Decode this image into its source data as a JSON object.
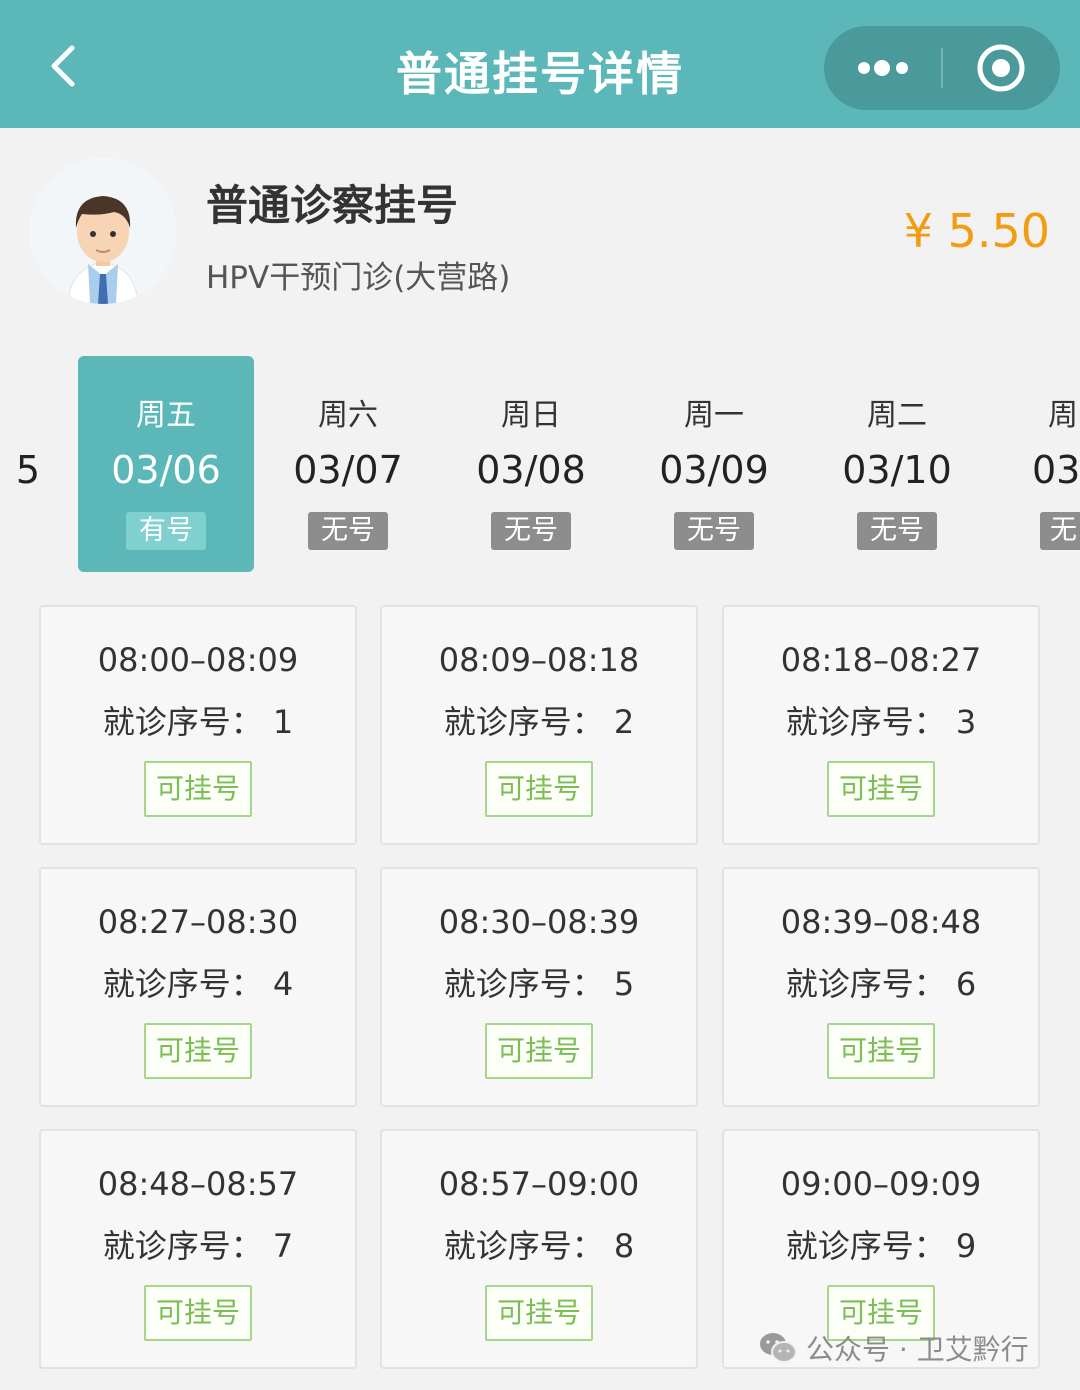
{
  "nav": {
    "title": "普通挂号详情"
  },
  "doctor": {
    "title": "普通诊察挂号",
    "subtitle": "HPV干预门诊(大营路)",
    "price": "¥ 5.50"
  },
  "dates": [
    {
      "weekday": "周五",
      "date": "03/06",
      "status": "有号",
      "active": true
    },
    {
      "weekday": "周六",
      "date": "03/07",
      "status": "无号",
      "active": false
    },
    {
      "weekday": "周日",
      "date": "03/08",
      "status": "无号",
      "active": false
    },
    {
      "weekday": "周一",
      "date": "03/09",
      "status": "无号",
      "active": false
    },
    {
      "weekday": "周二",
      "date": "03/10",
      "status": "无号",
      "active": false
    },
    {
      "weekday": "周",
      "date": "03/",
      "status": "无",
      "active": false
    }
  ],
  "date_partial_left": "5",
  "slots": [
    {
      "time": "08:00–08:09",
      "seq": "就诊序号： 1",
      "button": "可挂号"
    },
    {
      "time": "08:09–08:18",
      "seq": "就诊序号： 2",
      "button": "可挂号"
    },
    {
      "time": "08:18–08:27",
      "seq": "就诊序号： 3",
      "button": "可挂号"
    },
    {
      "time": "08:27–08:30",
      "seq": "就诊序号： 4",
      "button": "可挂号"
    },
    {
      "time": "08:30–08:39",
      "seq": "就诊序号： 5",
      "button": "可挂号"
    },
    {
      "time": "08:39–08:48",
      "seq": "就诊序号： 6",
      "button": "可挂号"
    },
    {
      "time": "08:48–08:57",
      "seq": "就诊序号： 7",
      "button": "可挂号"
    },
    {
      "time": "08:57–09:00",
      "seq": "就诊序号： 8",
      "button": "可挂号"
    },
    {
      "time": "09:00–09:09",
      "seq": "就诊序号： 9",
      "button": "可挂号"
    }
  ],
  "watermark": "公众号 · 卫艾黔行",
  "colors": {
    "theme": "#5cb8b8",
    "price": "#f39c12",
    "available": "#7dbd55",
    "unavailable_badge": "#8d8d8d"
  }
}
